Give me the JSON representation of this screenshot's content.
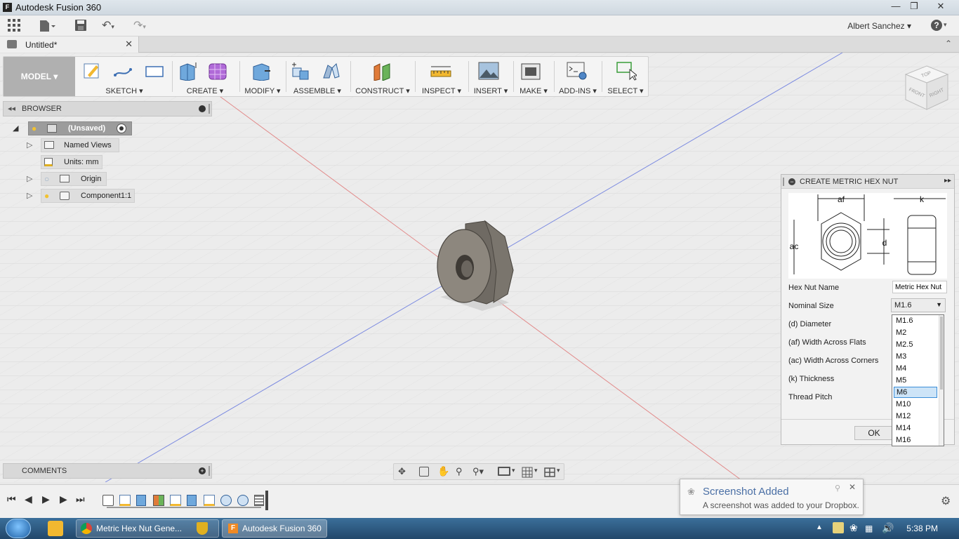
{
  "window": {
    "title": "Autodesk Fusion 360"
  },
  "appbar": {
    "user": "Albert Sanchez",
    "help": "?"
  },
  "doc_tab": {
    "title": "Untitled*"
  },
  "ribbon": {
    "workspace": "MODEL ▾",
    "groups": [
      {
        "label": "SKETCH ▾"
      },
      {
        "label": "CREATE ▾"
      },
      {
        "label": "MODIFY ▾"
      },
      {
        "label": "ASSEMBLE ▾"
      },
      {
        "label": "CONSTRUCT ▾"
      },
      {
        "label": "INSPECT ▾"
      },
      {
        "label": "INSERT ▾"
      },
      {
        "label": "MAKE ▾"
      },
      {
        "label": "ADD-INS ▾"
      },
      {
        "label": "SELECT ▾"
      }
    ]
  },
  "viewcube": {
    "top": "TOP",
    "front": "FRONT",
    "right": "RIGHT"
  },
  "browser": {
    "title": "BROWSER",
    "items": [
      {
        "label": "(Unsaved)"
      },
      {
        "label": "Named Views"
      },
      {
        "label": "Units: mm"
      },
      {
        "label": "Origin"
      },
      {
        "label": "Component1:1"
      }
    ]
  },
  "dialog": {
    "title": "CREATE METRIC HEX NUT",
    "diagram": {
      "af": "af",
      "k": "k",
      "ac": "ac",
      "d": "d"
    },
    "fields": [
      {
        "label": "Hex Nut Name",
        "value": "Metric Hex Nut"
      },
      {
        "label": "Nominal Size",
        "value": "M1.6"
      },
      {
        "label": "(d) Diameter"
      },
      {
        "label": "(af) Width Across Flats"
      },
      {
        "label": "(ac) Width Across Corners"
      },
      {
        "label": "(k) Thickness"
      },
      {
        "label": "Thread Pitch"
      }
    ],
    "ok": "OK",
    "size_options": [
      "M1.6",
      "M2",
      "M2.5",
      "M3",
      "M4",
      "M5",
      "M6",
      "M10",
      "M12",
      "M14",
      "M16"
    ],
    "selected_option": "M6"
  },
  "comments": {
    "title": "COMMENTS"
  },
  "toast": {
    "title": "Screenshot Added",
    "message": "A screenshot was added to your Dropbox."
  },
  "taskbar": {
    "tasks": [
      {
        "label": "Metric Hex Nut Gene..."
      },
      {
        "label": "Autodesk Fusion 360"
      }
    ],
    "clock": "5:38 PM"
  }
}
